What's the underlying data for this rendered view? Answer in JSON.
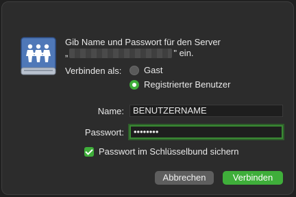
{
  "dialog": {
    "prompt_line1": "Gib Name und Passwort für den Server",
    "prompt_open_quote": "„",
    "prompt_suffix": "\" ein.",
    "connect_as_label": "Verbinden als:",
    "options": [
      {
        "label": "Gast",
        "selected": false
      },
      {
        "label": "Registrierter Benutzer",
        "selected": true
      }
    ],
    "name_label": "Name:",
    "name_value": "BENUTZERNAME",
    "password_label": "Passwort:",
    "password_value": "••••••••",
    "keychain_label": "Passwort im Schlüsselbund sichern",
    "keychain_checked": true,
    "cancel_label": "Abbrechen",
    "connect_label": "Verbinden"
  },
  "icons": {
    "server": "network-server-icon"
  },
  "colors": {
    "accent": "#3fae3a",
    "background": "#2c2c2c"
  }
}
